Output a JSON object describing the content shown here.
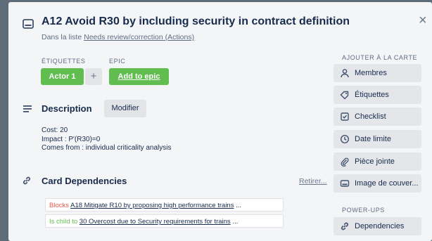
{
  "card": {
    "title": "A12 Avoid R30 by including security in contract definition",
    "list_prefix": "Dans la liste ",
    "list_name": "Needs review/correction (Actions)"
  },
  "labels": {
    "etiquettes_heading": "ÉTIQUETTES",
    "epic_heading": "EPIC",
    "actor_label": "Actor 1",
    "add_label": "+",
    "add_epic": "Add to epic"
  },
  "description": {
    "heading": "Description",
    "edit_button": "Modifier",
    "lines": [
      "Cost: 20",
      "Impact : P'(R30)=0",
      "Comes from : individual criticality analysis"
    ]
  },
  "dependencies": {
    "heading": "Card Dependencies",
    "remove": "Retirer...",
    "rows": [
      {
        "relation": "Blocks",
        "target": "A18 Mitigate R10 by proposing high performance trains",
        "ellipsis": "..."
      },
      {
        "relation": "Is child to",
        "target": "30 Overcost due to Security requirements for trains",
        "ellipsis": "..."
      }
    ]
  },
  "sidebar": {
    "add_heading": "AJOUTER À LA CARTE",
    "items": [
      {
        "label": "Membres",
        "icon": "person-icon"
      },
      {
        "label": "Étiquettes",
        "icon": "tag-icon"
      },
      {
        "label": "Checklist",
        "icon": "checklist-icon"
      },
      {
        "label": "Date limite",
        "icon": "clock-icon"
      },
      {
        "label": "Pièce jointe",
        "icon": "paperclip-icon"
      },
      {
        "label": "Image de couver...",
        "icon": "image-icon"
      }
    ],
    "powerups_heading": "POWER-UPS",
    "powerups": [
      {
        "label": "Dependencies",
        "icon": "link-icon"
      }
    ]
  },
  "colors": {
    "label_green": "#61bd4f",
    "blocks_red": "#eb5a46",
    "is_child_green": "#61bd4f",
    "modal_bg": "#f4f5f7"
  }
}
